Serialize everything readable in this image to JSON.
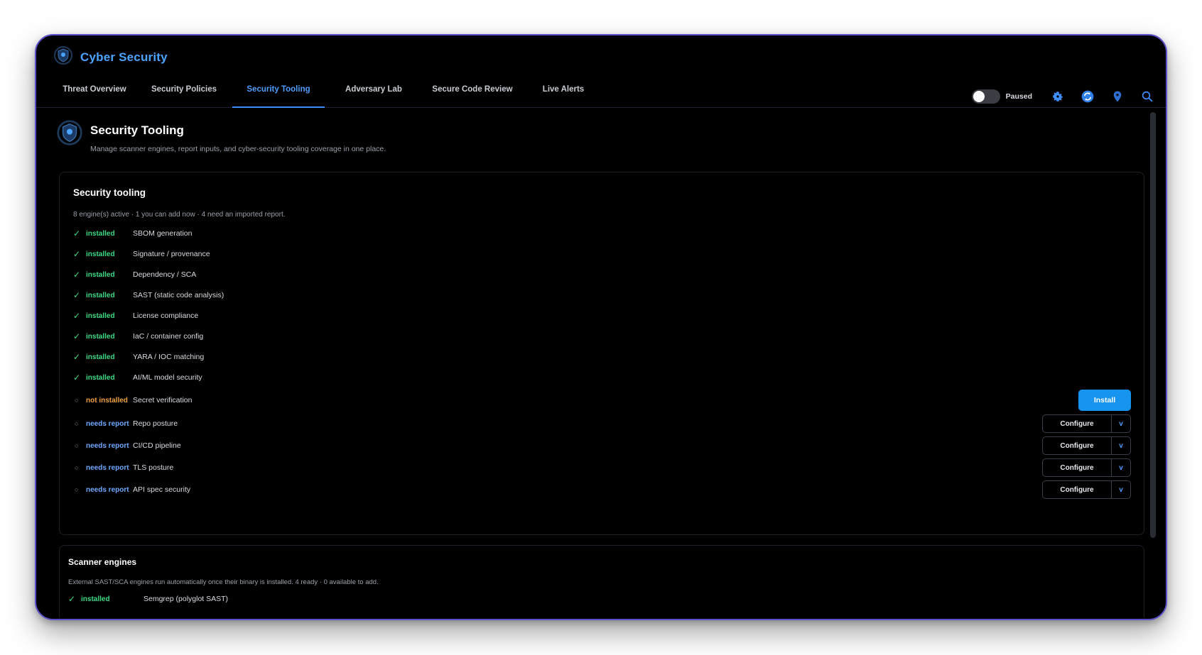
{
  "app": {
    "title": "Cyber Security",
    "logo_icon": "shield-emblem-icon"
  },
  "tabs": [
    {
      "label": "Threat Overview",
      "active": false
    },
    {
      "label": "Security Policies",
      "active": false
    },
    {
      "label": "Security Tooling",
      "active": true
    },
    {
      "label": "Adversary Lab",
      "active": false
    },
    {
      "label": "Secure Code Review",
      "active": false
    },
    {
      "label": "Live Alerts",
      "active": false
    }
  ],
  "toolbar": {
    "toggle_label": "Paused",
    "toggle_on": false,
    "icons": [
      "settings-gear-icon",
      "sync-icon",
      "map-pin-icon",
      "search-icon"
    ]
  },
  "page": {
    "title": "Security Tooling",
    "description": "Manage scanner engines, report inputs, and cyber-security tooling coverage in one place."
  },
  "tooling": {
    "title": "Security tooling",
    "summary": "8 engine(s) active · 1 you can add now · 4 need an imported report.",
    "items": [
      {
        "status": "installed",
        "name": "SBOM generation"
      },
      {
        "status": "installed",
        "name": "Signature / provenance"
      },
      {
        "status": "installed",
        "name": "Dependency / SCA"
      },
      {
        "status": "installed",
        "name": "SAST (static code analysis)"
      },
      {
        "status": "installed",
        "name": "License compliance"
      },
      {
        "status": "installed",
        "name": "IaC / container config"
      },
      {
        "status": "installed",
        "name": "YARA / IOC matching"
      },
      {
        "status": "installed",
        "name": "AI/ML model security"
      },
      {
        "status": "not installed",
        "name": "Secret verification",
        "action": "Install"
      },
      {
        "status": "needs report",
        "name": "Repo posture",
        "action": "Configure",
        "menu": "v"
      },
      {
        "status": "needs report",
        "name": "CI/CD pipeline",
        "action": "Configure",
        "menu": "v"
      },
      {
        "status": "needs report",
        "name": "TLS posture",
        "action": "Configure",
        "menu": "v"
      },
      {
        "status": "needs report",
        "name": "API spec security",
        "action": "Configure",
        "menu": "v"
      }
    ]
  },
  "engines": {
    "title": "Scanner engines",
    "summary": "External SAST/SCA engines run automatically once their binary is installed. 4 ready · 0 available to add.",
    "items": [
      {
        "status": "installed",
        "name": "Semgrep (polyglot SAST)"
      }
    ]
  },
  "colors": {
    "accent": "#1694f0",
    "installed": "#3ddc84",
    "not_installed": "#f0a040",
    "needs_report": "#6fa8ff",
    "frame": "#5b50c9"
  }
}
